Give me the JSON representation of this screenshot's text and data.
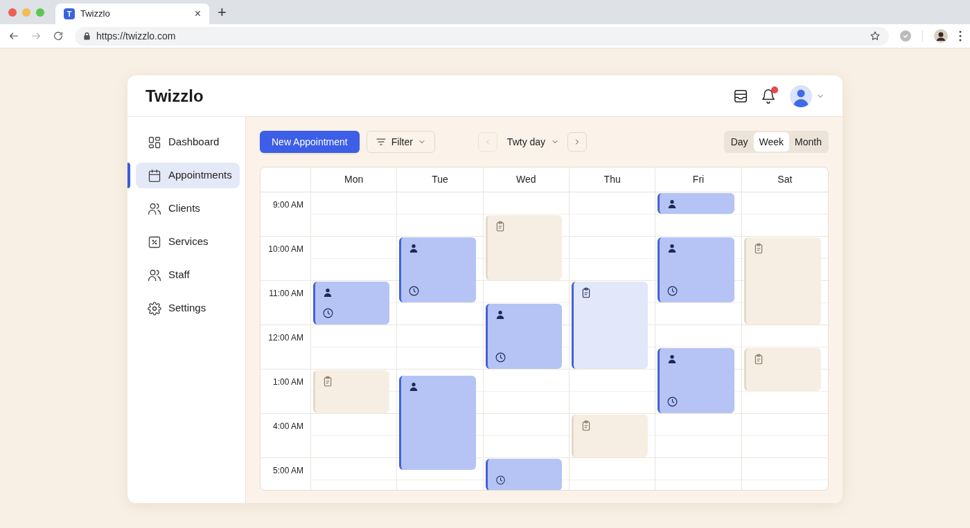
{
  "browser": {
    "tab_icon_letter": "T",
    "tab_title": "Twizzlo",
    "close": "×",
    "new_tab": "+",
    "url": "https://twizzlo.com"
  },
  "app": {
    "title": "Twizzlo",
    "notification": true
  },
  "sidebar": {
    "items": [
      {
        "label": "Dashboard",
        "selected": false
      },
      {
        "label": "Appointments",
        "selected": true
      },
      {
        "label": "Clients",
        "selected": false
      },
      {
        "label": "Services",
        "selected": false
      },
      {
        "label": "Staff",
        "selected": false
      },
      {
        "label": "Settings",
        "selected": false
      }
    ]
  },
  "toolbar": {
    "new_button": "New Appointment",
    "filter": "Filter",
    "period": "Twty day",
    "views": [
      {
        "label": "Day",
        "selected": false
      },
      {
        "label": "Week",
        "selected": true
      },
      {
        "label": "Month",
        "selected": false
      }
    ]
  },
  "calendar": {
    "times": [
      "9:00 AM",
      "10:00 AM",
      "11:00 AM",
      "12:00 AM",
      "1:00 AM",
      "4:00 AM",
      "5:00 AM"
    ],
    "columns": [
      {
        "day": "Mon",
        "events": [
          {
            "kind": "appointment",
            "client_icon": true,
            "time_icon": true
          },
          {
            "kind": "note"
          }
        ]
      },
      {
        "day": "Tue",
        "events": [
          {
            "kind": "appointment",
            "client_icon": true,
            "time_icon": true
          },
          {
            "kind": "appointment",
            "client_icon": true,
            "time_icon": false
          }
        ]
      },
      {
        "day": "Wed",
        "events": [
          {
            "kind": "note"
          },
          {
            "kind": "appointment",
            "client_icon": true,
            "time_icon": true
          },
          {
            "kind": "appointment",
            "client_icon": false,
            "time_icon": true
          }
        ]
      },
      {
        "day": "Thu",
        "events": [
          {
            "kind": "pending"
          },
          {
            "kind": "note"
          }
        ]
      },
      {
        "day": "Fri",
        "events": [
          {
            "kind": "appointment",
            "client_icon": true,
            "time_icon": false
          },
          {
            "kind": "appointment",
            "client_icon": true,
            "time_icon": true
          },
          {
            "kind": "appointment",
            "client_icon": true,
            "time_icon": true
          }
        ]
      },
      {
        "day": "Sat",
        "events": [
          {
            "kind": "note"
          },
          {
            "kind": "note"
          }
        ]
      }
    ]
  }
}
